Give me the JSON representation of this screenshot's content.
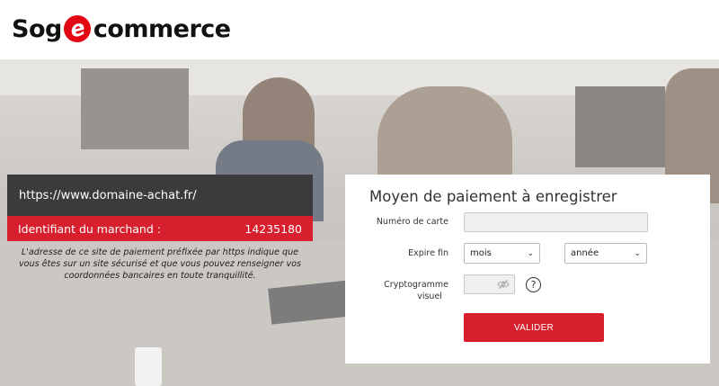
{
  "brand": {
    "part1": "Sog",
    "badge": "e",
    "part2": "commerce",
    "accent": "#e30613"
  },
  "merchant": {
    "url": "https://www.domaine-achat.fr/",
    "id_label": "Identifiant du marchand :",
    "id_value": "14235180",
    "note": "L'adresse de ce site de paiement préfixée par https indique que vous êtes sur un site sécurisé et que vous pouvez renseigner vos coordonnées bancaires en toute tranquillité."
  },
  "form": {
    "title": "Moyen de paiement à enregistrer",
    "card_number_label": "Numéro de carte",
    "card_number_value": "",
    "expiry_label": "Expire fin",
    "month_selected": "mois",
    "year_selected": "année",
    "cvv_label_line1": "Cryptogramme",
    "cvv_label_line2": "visuel",
    "help_symbol": "?",
    "submit_label": "VALIDER"
  },
  "icons": {
    "eye": "eye-slash-icon",
    "help": "question-circle-icon",
    "chevron": "chevron-down-icon"
  },
  "colors": {
    "button": "#d71f2d",
    "dark_panel": "#3b3b3d"
  }
}
